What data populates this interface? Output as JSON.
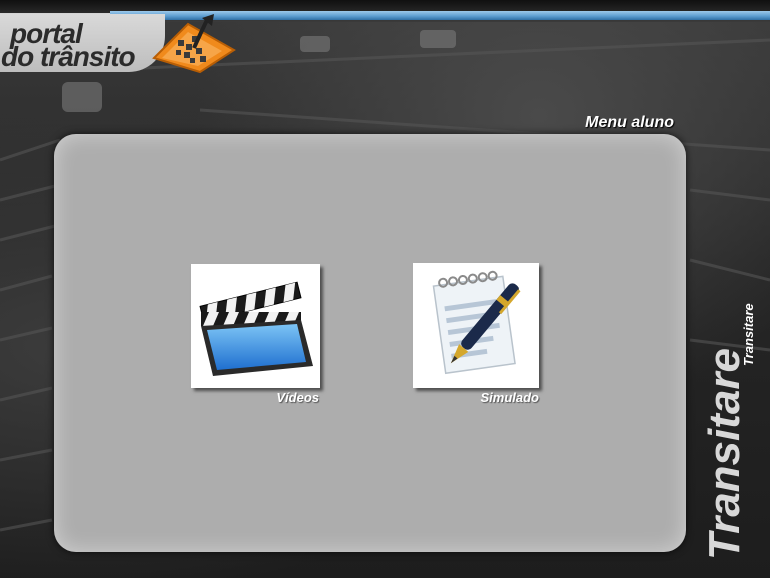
{
  "header": {
    "logo_line1": "portal",
    "logo_line2": "do trânsito"
  },
  "menu": {
    "title": "Menu aluno",
    "items": [
      {
        "label": "Vídeos",
        "icon": "clapperboard-icon"
      },
      {
        "label": "Simulado",
        "icon": "notepad-pen-icon"
      }
    ]
  },
  "brand": {
    "big": "Transitare",
    "small": "Transitare"
  },
  "colors": {
    "panel": "#adadad",
    "accent_blue": "#5f9fd2",
    "logo_orange": "#f08a1c"
  }
}
